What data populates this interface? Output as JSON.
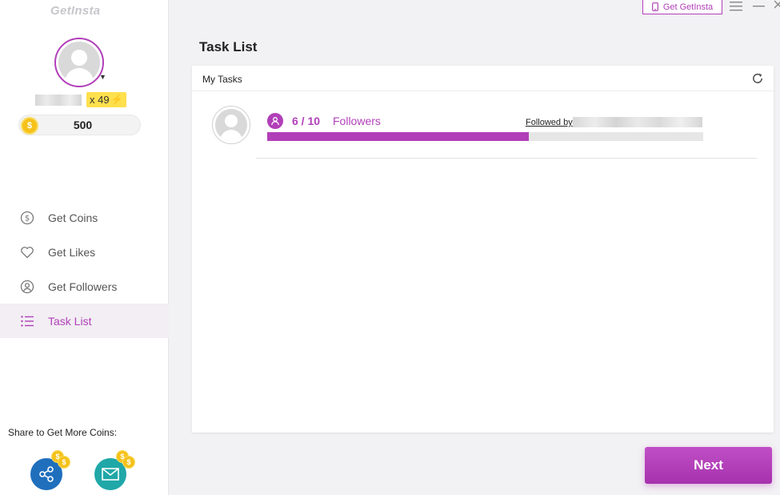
{
  "app": {
    "brand": "GetInsta",
    "accent": "#b13fb8"
  },
  "topbar": {
    "get_button_label": "Get GetInsta"
  },
  "profile": {
    "multiplier": "x 49",
    "coins": "500"
  },
  "nav": {
    "items": [
      {
        "label": "Get Coins",
        "icon": "dollar-circle-icon",
        "active": false
      },
      {
        "label": "Get Likes",
        "icon": "heart-icon",
        "active": false
      },
      {
        "label": "Get Followers",
        "icon": "user-circle-icon",
        "active": false
      },
      {
        "label": "Task List",
        "icon": "list-icon",
        "active": true
      }
    ]
  },
  "share": {
    "label": "Share to Get More Coins:"
  },
  "main": {
    "title": "Task List",
    "card_title": "My Tasks",
    "tasks": [
      {
        "progress_text": "6 / 10",
        "type_label": "Followers",
        "followed_by_label": "Followed by",
        "progress_fraction": 0.6
      }
    ],
    "next_label": "Next"
  }
}
